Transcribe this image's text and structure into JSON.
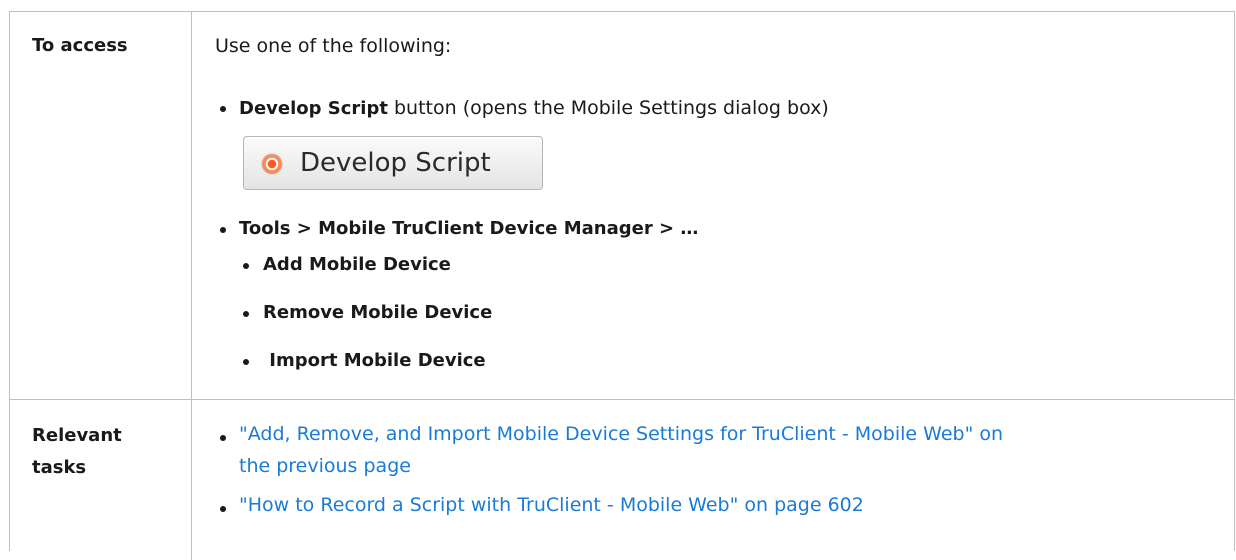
{
  "access": {
    "header": "To access",
    "intro": "Use one of the following:",
    "item1_bold": "Develop Script",
    "item1_rest": " button (opens the Mobile Settings dialog box)",
    "button_label": "Develop Script",
    "button_icon": "record-icon",
    "item2_bold": "Tools > Mobile TruClient Device Manager > …",
    "subitems": [
      "Add Mobile Device",
      "Remove Mobile Device",
      " Import Mobile Device"
    ]
  },
  "relevant": {
    "header_line1": "Relevant",
    "header_line2": "tasks",
    "link1_line1": "\"Add, Remove, and Import Mobile Device Settings for TruClient - Mobile Web\" on",
    "link1_line2": "the previous page",
    "link2": "\"How to Record a Script with TruClient - Mobile Web\" on page 602"
  },
  "colors": {
    "link": "#1a7bd6",
    "border": "#bfbfbf",
    "record_icon": "#ff5a1e"
  }
}
